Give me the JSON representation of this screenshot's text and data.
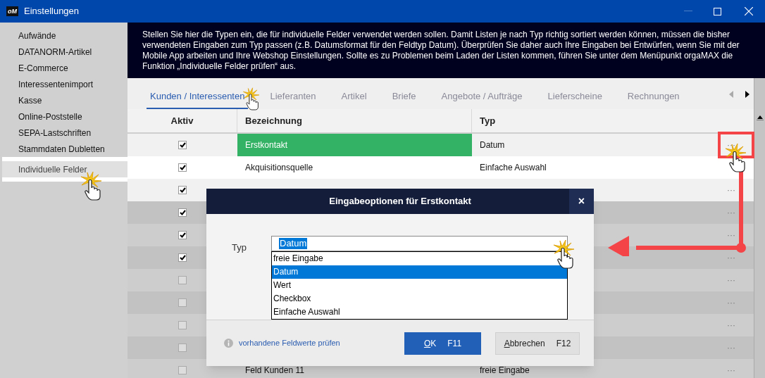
{
  "window": {
    "logo": "oM",
    "title": "Einstellungen"
  },
  "sidebar": {
    "items": [
      {
        "label": "Aufwände",
        "selected": false
      },
      {
        "label": "DATANORM-Artikel",
        "selected": false
      },
      {
        "label": "E-Commerce",
        "selected": false
      },
      {
        "label": "Interessentenimport",
        "selected": false
      },
      {
        "label": "Kasse",
        "selected": false
      },
      {
        "label": "Online-Poststelle",
        "selected": false
      },
      {
        "label": "SEPA-Lastschriften",
        "selected": false
      },
      {
        "label": "Stammdaten Dubletten",
        "selected": false
      },
      {
        "label": "Individuelle Felder",
        "selected": true
      }
    ]
  },
  "info_text": "Stellen Sie hier die Typen ein, die für individuelle Felder verwendet werden sollen. Damit Listen je nach Typ richtig sortiert werden können, müssen die bisher verwendeten Eingaben zum Typ passen (z.B. Datumsformat für den Feldtyp Datum). Überprüfen Sie daher auch Ihre Eingaben bei Entwürfen, wenn Sie mit der Mobile App arbeiten und Ihre Webshop Einstellungen. Sollte es zu Problemen beim Laden der Listen kommen, führen Sie unter dem Menüpunkt orgaMAX die Funktion „Individuelle Felder prüfen“ aus.",
  "tabs": [
    {
      "label": "Kunden / Interessenten",
      "selected": true
    },
    {
      "label": "Lieferanten",
      "selected": false
    },
    {
      "label": "Artikel",
      "selected": false
    },
    {
      "label": "Briefe",
      "selected": false
    },
    {
      "label": "Angebote / Aufträge",
      "selected": false
    },
    {
      "label": "Lieferscheine",
      "selected": false
    },
    {
      "label": "Rechnungen",
      "selected": false
    }
  ],
  "tab_scroll": {
    "back_enabled": false,
    "forward_enabled": true
  },
  "table": {
    "columns": [
      "Aktiv",
      "Bezeichnung",
      "Typ"
    ],
    "rows": [
      {
        "checked": true,
        "name": "Erstkontakt",
        "type": "Datum",
        "selected": true,
        "dimmed": false,
        "action": "···"
      },
      {
        "checked": true,
        "name": "Akquisitionsquelle",
        "type": "Einfache Auswahl",
        "selected": false,
        "dimmed": false
      },
      {
        "checked": true,
        "dimmed": false,
        "action": "···"
      },
      {
        "checked": true,
        "dimmed": true,
        "action": "···"
      },
      {
        "checked": true,
        "dimmed": true,
        "action": "···"
      },
      {
        "checked": true,
        "dimmed": true,
        "action": "···"
      },
      {
        "checked": false,
        "dimmed": true,
        "action": "···"
      },
      {
        "checked": false,
        "dimmed": true,
        "action": "···"
      },
      {
        "checked": false,
        "dimmed": true,
        "action": "···"
      },
      {
        "checked": false,
        "dimmed": true,
        "action": "···"
      },
      {
        "checked": false,
        "name": "Feld Kunden 11",
        "type": "freie Eingabe",
        "selected": false,
        "dimmed": true,
        "action": "···"
      }
    ]
  },
  "dialog": {
    "title": "Eingabeoptionen für Erstkontakt",
    "close": "×",
    "field_label": "Typ",
    "value": "Datum",
    "options": [
      {
        "label": "freie Eingabe",
        "selected": false
      },
      {
        "label": "Datum",
        "selected": true
      },
      {
        "label": "Wert",
        "selected": false
      },
      {
        "label": "Checkbox",
        "selected": false
      },
      {
        "label": "Einfache Auswahl",
        "selected": false
      }
    ],
    "link": "vorhandene Feldwerte prüfen",
    "buttons": [
      {
        "label": "OK",
        "shortcut": "F11",
        "kind": "primary"
      },
      {
        "label": "Abbrechen",
        "shortcut": "F12",
        "kind": "secondary"
      }
    ]
  }
}
